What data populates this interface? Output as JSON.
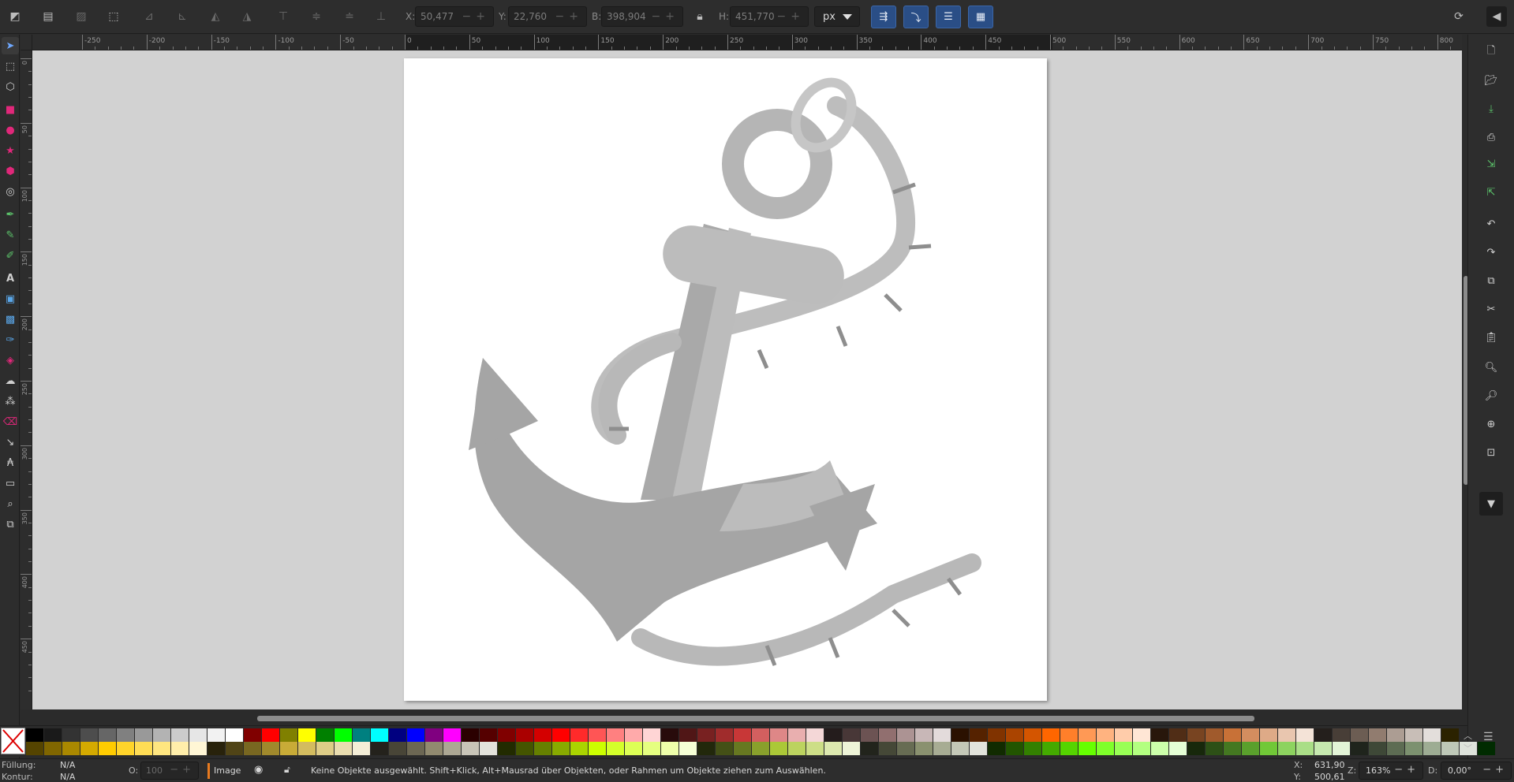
{
  "toolbar": {
    "x_label": "X:",
    "x_value": "50,477",
    "y_label": "Y:",
    "y_value": "22,760",
    "w_label": "B:",
    "w_value": "398,904",
    "h_label": "H:",
    "h_value": "451,770",
    "unit": "px"
  },
  "rulers": {
    "top_labels": [
      "-250",
      "-200",
      "-150",
      "-100",
      "-50",
      "0",
      "50",
      "100",
      "150",
      "200",
      "250",
      "300",
      "350",
      "400",
      "450",
      "500",
      "550",
      "600",
      "650",
      "700",
      "750",
      "800"
    ],
    "left_labels": [
      "0",
      "50",
      "100",
      "150",
      "200",
      "250",
      "300",
      "350",
      "400",
      "450"
    ]
  },
  "status": {
    "fill_label": "Füllung:",
    "fill_value": "N/A",
    "stroke_label": "Kontur:",
    "stroke_value": "N/A",
    "opacity_label": "O:",
    "opacity_value": "100",
    "layer_name": "Image",
    "message": "Keine Objekte ausgewählt. Shift+Klick, Alt+Mausrad über Objekten, oder Rahmen um Objekte ziehen zum Auswählen.",
    "cursor_x_label": "X:",
    "cursor_x": "631,90",
    "cursor_y_label": "Y:",
    "cursor_y": "500,61",
    "zoom_label": "Z:",
    "zoom": "163%",
    "rotation_label": "D:",
    "rotation": "0,00°"
  },
  "colors": {
    "accent": "#2a4e86",
    "anchor_dark": "#a5a5a5",
    "anchor_light": "#c0c0c0",
    "rope_stripe": "#8e8e8e"
  },
  "palette": {
    "row1": [
      "#000000",
      "#1a1a1a",
      "#333333",
      "#4d4d4d",
      "#666666",
      "#808080",
      "#999999",
      "#b3b3b3",
      "#cccccc",
      "#e6e6e6",
      "#f2f2f2",
      "#ffffff",
      "#800000",
      "#ff0000",
      "#808000",
      "#ffff00",
      "#008000",
      "#00ff00",
      "#008080",
      "#00ffff",
      "#000080",
      "#0000ff",
      "#800080",
      "#ff00ff",
      "#2b0000",
      "#550000",
      "#800000",
      "#aa0000",
      "#d40000",
      "#ff0000",
      "#ff2a2a",
      "#ff5555",
      "#ff8080",
      "#ffaaaa",
      "#ffd5d5",
      "#280b0b",
      "#501616",
      "#782121",
      "#a02c2c",
      "#c83737",
      "#d35f5f",
      "#de8787",
      "#e9afaf",
      "#f4d7d7",
      "#241c1c",
      "#483737",
      "#6c5353",
      "#916f6f",
      "#ac9393",
      "#c8b7b7",
      "#e3dbdb",
      "#2b1100",
      "#552200",
      "#803300",
      "#aa4400",
      "#d45500",
      "#ff6600",
      "#ff7f2a",
      "#ff9955",
      "#ffb380",
      "#ffccaa",
      "#ffe6d5",
      "#28170b",
      "#502d16",
      "#784421",
      "#a05a2c",
      "#c87137",
      "#d38d5f",
      "#deaa87",
      "#e9c6af",
      "#f4e3d7",
      "#241f1c",
      "#483e37",
      "#6c5d53",
      "#917c6f",
      "#ac9d93",
      "#c8beb7",
      "#e3dedb",
      "#2b2200"
    ],
    "row2": [
      "#554400",
      "#806600",
      "#aa8800",
      "#d4aa00",
      "#ffcc00",
      "#ffd42a",
      "#ffdd55",
      "#ffe680",
      "#ffeeaa",
      "#fff6d5",
      "#28220b",
      "#504416",
      "#786721",
      "#a0892c",
      "#c8ab37",
      "#d3bc5f",
      "#decd87",
      "#e9ddaf",
      "#f4eed7",
      "#24221c",
      "#484537",
      "#6c6753",
      "#918a6f",
      "#aca793",
      "#c8c4b7",
      "#e3e2db",
      "#222b00",
      "#445500",
      "#668000",
      "#88aa00",
      "#aad400",
      "#ccff00",
      "#d4ff2a",
      "#ddff55",
      "#e5ff80",
      "#eeffaa",
      "#f6ffd5",
      "#22280b",
      "#445016",
      "#677821",
      "#89a02c",
      "#abc837",
      "#bcd35f",
      "#cdde87",
      "#dde9af",
      "#eef4d7",
      "#22241c",
      "#454837",
      "#676c53",
      "#8a916f",
      "#a7ac93",
      "#c4c8b7",
      "#e2e3db",
      "#112b00",
      "#225500",
      "#338000",
      "#44aa00",
      "#55d400",
      "#66ff00",
      "#7fff2a",
      "#99ff55",
      "#b3ff80",
      "#ccffaa",
      "#e5ffd5",
      "#17280b",
      "#2d5016",
      "#447821",
      "#5aa02c",
      "#71c837",
      "#8dd35f",
      "#aade87",
      "#c6e9af",
      "#e3f4d7",
      "#1f241c",
      "#3e4837",
      "#5d6c53",
      "#7c916f",
      "#9dac93",
      "#bec8b7",
      "#dee3db",
      "#002b00"
    ]
  }
}
